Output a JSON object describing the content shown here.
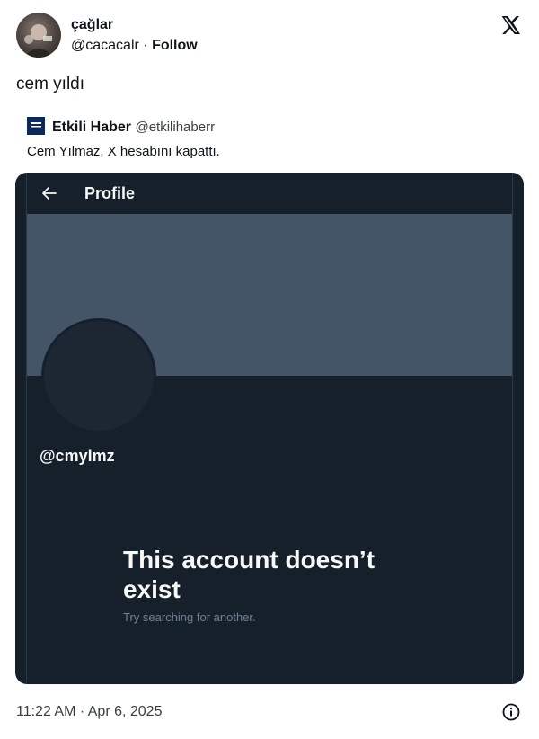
{
  "author": {
    "display_name": "çağlar",
    "handle": "@cacacalr",
    "separator": "·",
    "follow_label": "Follow"
  },
  "tweet": {
    "text": "cem yıldı"
  },
  "quoted": {
    "name": "Etkili Haber",
    "handle": "@etkilihaberr",
    "text": "Cem Yılmaz, X hesabını kapattı."
  },
  "media": {
    "header_title": "Profile",
    "profile_handle": "@cmylmz",
    "message_title": "This account doesn’t exist",
    "message_sub": "Try searching for another."
  },
  "footer": {
    "timestamp": "11:22 AM · Apr 6, 2025"
  },
  "colors": {
    "dark_bg": "#15202b",
    "banner": "#435566",
    "text_light": "#f7f9f9",
    "muted": "#6f8294"
  },
  "icons": {
    "platform_logo": "x-logo-icon",
    "back": "arrow-left-icon",
    "info": "info-icon"
  }
}
